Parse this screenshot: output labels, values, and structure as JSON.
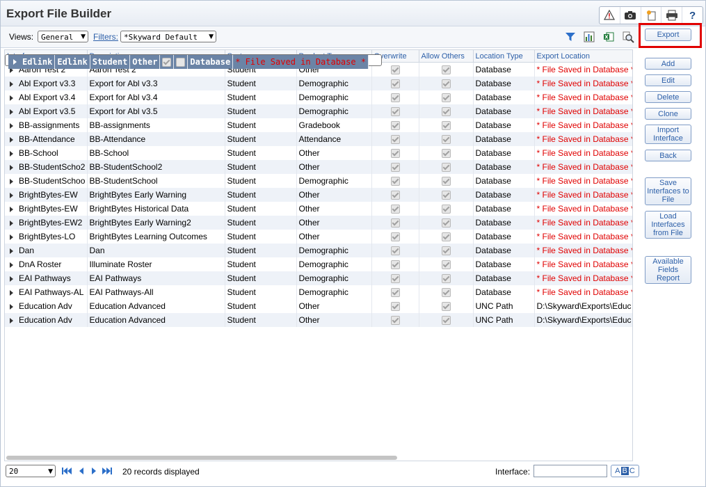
{
  "window": {
    "title": "Export File Builder"
  },
  "toolbar": {
    "views_label": "Views:",
    "views_value": "General",
    "filters_label": "Filters:",
    "filters_value": "*Skyward Default"
  },
  "grid": {
    "columns": [
      "Interface",
      "Description",
      "System",
      "Product Type",
      "Overwrite",
      "Allow Others",
      "Location Type",
      "Export Location"
    ],
    "rows": [
      {
        "interface": "Aaron Test 2",
        "description": "Aaron Test 2",
        "system": "Student",
        "product_type": "Other",
        "overwrite": true,
        "allow_others": true,
        "location_type": "Database",
        "export_location": "* File Saved in Database *"
      },
      {
        "interface": "Abl Export v3.3",
        "description": "Export for Abl v3.3",
        "system": "Student",
        "product_type": "Demographic",
        "overwrite": true,
        "allow_others": true,
        "location_type": "Database",
        "export_location": "* File Saved in Database *"
      },
      {
        "interface": "Abl Export v3.4",
        "description": "Export for Abl v3.4",
        "system": "Student",
        "product_type": "Demographic",
        "overwrite": true,
        "allow_others": true,
        "location_type": "Database",
        "export_location": "* File Saved in Database *"
      },
      {
        "interface": "Abl Export v3.5",
        "description": "Export for Abl v3.5",
        "system": "Student",
        "product_type": "Demographic",
        "overwrite": true,
        "allow_others": true,
        "location_type": "Database",
        "export_location": "* File Saved in Database *"
      },
      {
        "interface": "BB-assignments",
        "description": "BB-assignments",
        "system": "Student",
        "product_type": "Gradebook",
        "overwrite": true,
        "allow_others": true,
        "location_type": "Database",
        "export_location": "* File Saved in Database *"
      },
      {
        "interface": "BB-Attendance",
        "description": "BB-Attendance",
        "system": "Student",
        "product_type": "Attendance",
        "overwrite": true,
        "allow_others": true,
        "location_type": "Database",
        "export_location": "* File Saved in Database *"
      },
      {
        "interface": "BB-School",
        "description": "BB-School",
        "system": "Student",
        "product_type": "Other",
        "overwrite": true,
        "allow_others": true,
        "location_type": "Database",
        "export_location": "* File Saved in Database *"
      },
      {
        "interface": "BB-StudentScho2",
        "description": "BB-StudentSchool2",
        "system": "Student",
        "product_type": "Other",
        "overwrite": true,
        "allow_others": true,
        "location_type": "Database",
        "export_location": "* File Saved in Database *"
      },
      {
        "interface": "BB-StudentSchoo",
        "description": "BB-StudentSchool",
        "system": "Student",
        "product_type": "Demographic",
        "overwrite": true,
        "allow_others": true,
        "location_type": "Database",
        "export_location": "* File Saved in Database *"
      },
      {
        "interface": "BrightBytes-EW",
        "description": "BrightBytes Early Warning",
        "system": "Student",
        "product_type": "Other",
        "overwrite": true,
        "allow_others": true,
        "location_type": "Database",
        "export_location": "* File Saved in Database *"
      },
      {
        "interface": "BrightBytes-EW",
        "description": "BrightBytes Historical Data",
        "system": "Student",
        "product_type": "Other",
        "overwrite": true,
        "allow_others": true,
        "location_type": "Database",
        "export_location": "* File Saved in Database *"
      },
      {
        "interface": "BrightBytes-EW2",
        "description": "BrightBytes Early Warning2",
        "system": "Student",
        "product_type": "Other",
        "overwrite": true,
        "allow_others": true,
        "location_type": "Database",
        "export_location": "* File Saved in Database *"
      },
      {
        "interface": "BrightBytes-LO",
        "description": "BrightBytes Learning Outcomes",
        "system": "Student",
        "product_type": "Other",
        "overwrite": true,
        "allow_others": true,
        "location_type": "Database",
        "export_location": "* File Saved in Database *"
      },
      {
        "interface": "Dan",
        "description": "Dan",
        "system": "Student",
        "product_type": "Demographic",
        "overwrite": true,
        "allow_others": true,
        "location_type": "Database",
        "export_location": "* File Saved in Database *"
      },
      {
        "interface": "DnA Roster",
        "description": "Illuminate Roster",
        "system": "Student",
        "product_type": "Demographic",
        "overwrite": true,
        "allow_others": true,
        "location_type": "Database",
        "export_location": "* File Saved in Database *"
      },
      {
        "interface": "EAI Pathways",
        "description": "EAI Pathways",
        "system": "Student",
        "product_type": "Demographic",
        "overwrite": true,
        "allow_others": true,
        "location_type": "Database",
        "export_location": "* File Saved in Database *"
      },
      {
        "interface": "EAI Pathways-AL",
        "description": "EAI Pathways-All",
        "system": "Student",
        "product_type": "Demographic",
        "overwrite": true,
        "allow_others": true,
        "location_type": "Database",
        "export_location": "* File Saved in Database *"
      },
      {
        "interface": "Edlink",
        "description": "Edlink",
        "system": "Student",
        "product_type": "Other",
        "overwrite": true,
        "allow_others": false,
        "location_type": "Database",
        "export_location": "* File Saved in Database *",
        "selected": true
      },
      {
        "interface": "Education Adv",
        "description": "Education Advanced",
        "system": "Student",
        "product_type": "Other",
        "overwrite": true,
        "allow_others": true,
        "location_type": "UNC Path",
        "export_location": "D:\\Skyward\\Exports\\Educ"
      },
      {
        "interface": "Education Adv",
        "description": "Education Advanced",
        "system": "Student",
        "product_type": "Other",
        "overwrite": true,
        "allow_others": true,
        "location_type": "UNC Path",
        "export_location": "D:\\Skyward\\Exports\\Educ"
      }
    ]
  },
  "actions": {
    "export": "Export",
    "add": "Add",
    "edit": "Edit",
    "delete": "Delete",
    "clone": "Clone",
    "import_interface": "Import Interface",
    "back": "Back",
    "save_interfaces": "Save Interfaces to File",
    "load_interfaces": "Load Interfaces from File",
    "available_fields": "Available Fields Report"
  },
  "footer": {
    "page_size": "20",
    "records_text": "20 records displayed",
    "interface_label": "Interface:",
    "interface_value": "",
    "abc_a": "A",
    "abc_b": "B",
    "abc_c": "C"
  },
  "colors": {
    "accent": "#2c5fa8",
    "selected_row": "#6b84a6",
    "highlight": "#e00000"
  }
}
